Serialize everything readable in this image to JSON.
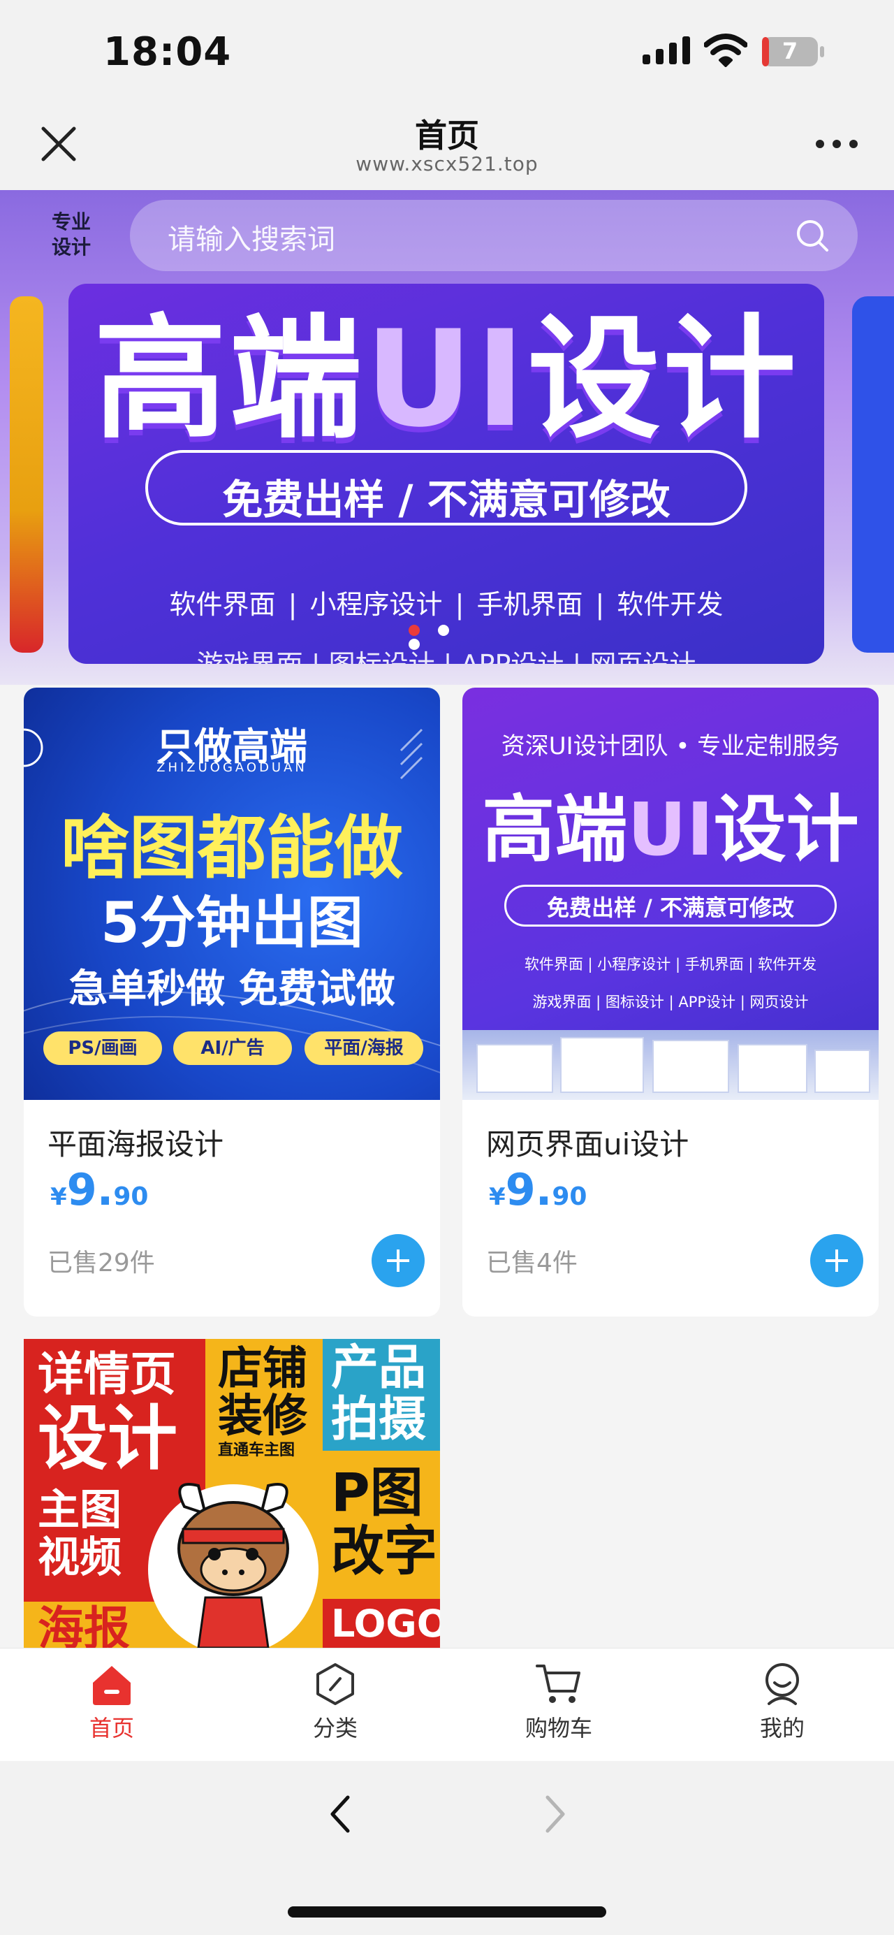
{
  "status_bar": {
    "time": "18:04",
    "battery": "7"
  },
  "header": {
    "title": "首页",
    "url": "www.xscx521.top"
  },
  "hero": {
    "logo_line1": "专业",
    "logo_line2": "设计",
    "search_placeholder": "请输入搜索词",
    "banner": {
      "title_prefix": "高端",
      "title_ui": "UI",
      "title_suffix": "设计",
      "subtitle": "免费出样 / 不满意可修改",
      "tags_row1": "软件界面 | 小程序设计 | 手机界面 | 软件开发",
      "tags_row2": "游戏界面 | 图标设计 | APP设计 | 网页设计"
    },
    "carousel_index": 1,
    "carousel_count": 3
  },
  "products": [
    {
      "name": "平面海报设计",
      "price_currency": "¥",
      "price_int": "9.",
      "price_dec": "90",
      "sold": "已售29件",
      "image": {
        "t1": "只做高端",
        "t1s": "ZHIZUOGAODUAN",
        "t2": "啥图都能做",
        "t3": "5分钟出图",
        "t4": "急单秒做 免费试做",
        "chips": [
          "PS/画画",
          "AI/广告",
          "平面/海报"
        ]
      }
    },
    {
      "name": "网页界面ui设计",
      "price_currency": "¥",
      "price_int": "9.",
      "price_dec": "90",
      "sold": "已售4件",
      "image": {
        "t1": "资深UI设计团队 • 专业定制服务",
        "t2_prefix": "高端",
        "t2_ui": "UI",
        "t2_suffix": "设计",
        "t3": "免费出样 / 不满意可修改",
        "r1": "软件界面 | 小程序设计 | 手机界面 | 软件开发",
        "r2": "游戏界面 | 图标设计 | APP设计 | 网页设计"
      }
    },
    {
      "image": {
        "a": "详情页",
        "b": "设计",
        "c": "主图",
        "d": "视频",
        "e": "海报",
        "f": "店铺",
        "g": "装修",
        "h": "直通车主图",
        "i": "产品",
        "j": "拍摄",
        "k": "P图",
        "l": "改字",
        "m": "LOGO"
      }
    }
  ],
  "tabbar": [
    {
      "label": "首页",
      "icon": "home-icon",
      "active": true
    },
    {
      "label": "分类",
      "icon": "category-icon",
      "active": false
    },
    {
      "label": "购物车",
      "icon": "cart-icon",
      "active": false
    },
    {
      "label": "我的",
      "icon": "profile-icon",
      "active": false
    }
  ],
  "colors": {
    "accent_red": "#e8322f",
    "price_blue": "#2d8cf0",
    "add_button": "#2aa3ee"
  }
}
